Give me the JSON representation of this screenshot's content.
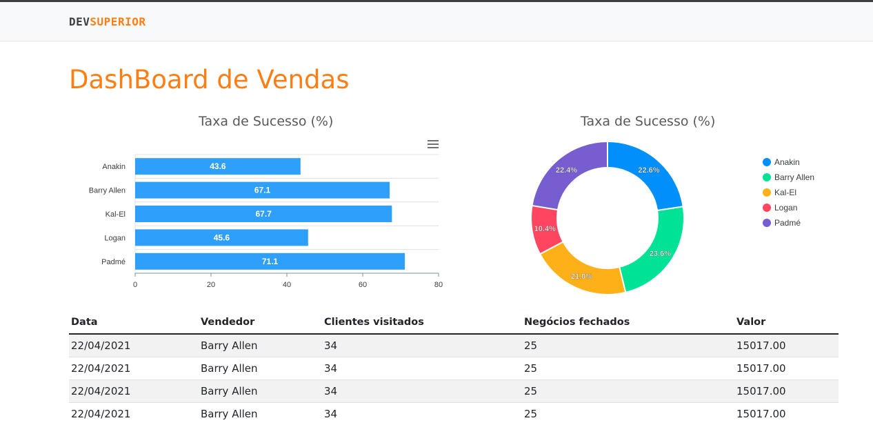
{
  "brand": {
    "dev": "DEV",
    "superior": "SUPERIOR"
  },
  "page_title": "DashBoard de Vendas",
  "colors": {
    "accent": "#fd7e14",
    "bar": "#2e9ffb",
    "donut": [
      "#008ffb",
      "#00e396",
      "#feb019",
      "#ff4560",
      "#775dd0"
    ]
  },
  "chart_data": [
    {
      "type": "bar",
      "orientation": "horizontal",
      "title": "Taxa de Sucesso (%)",
      "categories": [
        "Anakin",
        "Barry Allen",
        "Kal-El",
        "Logan",
        "Padmé"
      ],
      "values": [
        43.6,
        67.1,
        67.7,
        45.6,
        71.1
      ],
      "value_labels": [
        "43.6",
        "67.1",
        "67.7",
        "45.6",
        "71.1"
      ],
      "xlim": [
        0,
        80
      ],
      "x_ticks": [
        "0",
        "20",
        "40",
        "60",
        "80"
      ],
      "grid": true,
      "menu_icon": "hamburger-icon"
    },
    {
      "type": "pie",
      "variant": "donut",
      "title": "Taxa de Sucesso (%)",
      "labels": [
        "Anakin",
        "Barry Allen",
        "Kal-El",
        "Logan",
        "Padmé"
      ],
      "values": [
        22.6,
        23.6,
        21.0,
        10.4,
        22.4
      ],
      "value_labels": [
        "22.6%",
        "23.6%",
        "21.0%",
        "10.4%",
        "22.4%"
      ],
      "legend": "right"
    }
  ],
  "table": {
    "headers": [
      "Data",
      "Vendedor",
      "Clientes visitados",
      "Negócios fechados",
      "Valor"
    ],
    "rows": [
      [
        "22/04/2021",
        "Barry Allen",
        "34",
        "25",
        "15017.00"
      ],
      [
        "22/04/2021",
        "Barry Allen",
        "34",
        "25",
        "15017.00"
      ],
      [
        "22/04/2021",
        "Barry Allen",
        "34",
        "25",
        "15017.00"
      ],
      [
        "22/04/2021",
        "Barry Allen",
        "34",
        "25",
        "15017.00"
      ]
    ]
  }
}
